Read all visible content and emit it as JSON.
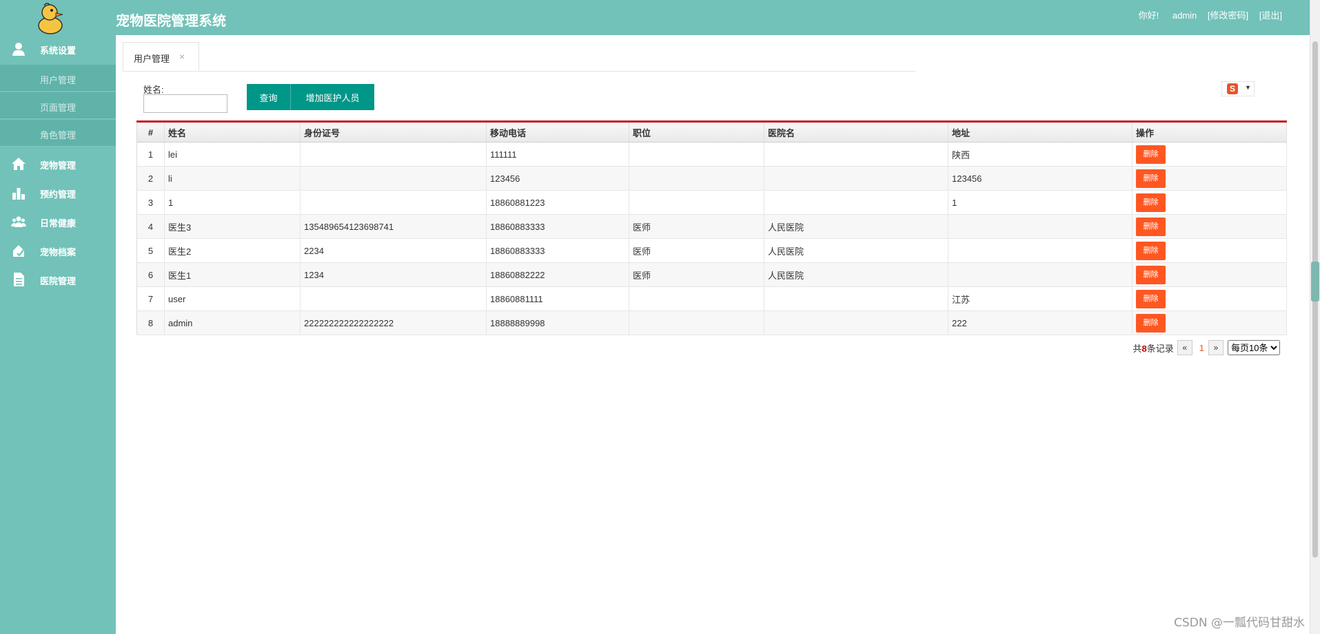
{
  "header": {
    "title": "宠物医院管理系统",
    "greeting": "你好!",
    "username": "admin",
    "change_password": "[修改密码]",
    "logout": "[退出]"
  },
  "sidebar": {
    "items": [
      {
        "label": "系统设置",
        "icon": "user-icon"
      },
      {
        "label": "宠物管理",
        "icon": "home-icon"
      },
      {
        "label": "预约管理",
        "icon": "bar-chart-icon"
      },
      {
        "label": "日常健康",
        "icon": "users-icon"
      },
      {
        "label": "宠物档案",
        "icon": "pet-record-icon"
      },
      {
        "label": "医院管理",
        "icon": "document-icon"
      }
    ],
    "sub_items": [
      "用户管理",
      "页面管理",
      "角色管理"
    ]
  },
  "tab": {
    "label": "用户管理",
    "close": "×"
  },
  "search": {
    "label": "姓名:",
    "value": "",
    "query_button": "查询",
    "add_button": "增加医护人员"
  },
  "badge": {
    "letter": "S",
    "caret": "▼"
  },
  "table": {
    "headers": [
      "#",
      "姓名",
      "身份证号",
      "移动电话",
      "职位",
      "医院名",
      "地址",
      "操作"
    ],
    "delete_label": "删除",
    "rows": [
      [
        "1",
        "lei",
        "",
        "111111",
        "",
        "",
        "陕西"
      ],
      [
        "2",
        "li",
        "",
        "123456",
        "",
        "",
        "123456"
      ],
      [
        "3",
        "1",
        "",
        "18860881223",
        "",
        "",
        "1"
      ],
      [
        "4",
        "医生3",
        "135489654123698741",
        "18860883333",
        "医师",
        "人民医院",
        ""
      ],
      [
        "5",
        "医生2",
        "2234",
        "18860883333",
        "医师",
        "人民医院",
        ""
      ],
      [
        "6",
        "医生1",
        "1234",
        "18860882222",
        "医师",
        "人民医院",
        ""
      ],
      [
        "7",
        "user",
        "",
        "18860881111",
        "",
        "",
        "江苏"
      ],
      [
        "8",
        "admin",
        "222222222222222222",
        "18888889998",
        "",
        "",
        "222"
      ]
    ]
  },
  "pager": {
    "total_prefix": "共",
    "total_count": "8",
    "total_suffix": "条记录",
    "prev": "«",
    "current": "1",
    "next": "»",
    "page_size": "每页10条"
  },
  "watermark": "CSDN @一瓢代码甘甜水",
  "colors": {
    "sidebar": "#72c2b9",
    "primary_button": "#009688",
    "delete_button": "#ff5722"
  }
}
